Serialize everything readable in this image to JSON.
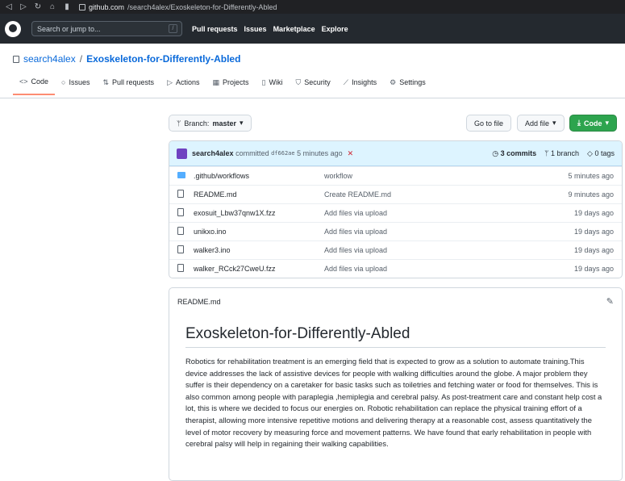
{
  "browser": {
    "url_host": "github.com",
    "url_path": "/search4alex/Exoskeleton-for-Differently-Abled"
  },
  "header": {
    "search_placeholder": "Search or jump to...",
    "search_shortcut": "/",
    "nav": [
      "Pull requests",
      "Issues",
      "Marketplace",
      "Explore"
    ]
  },
  "repo": {
    "owner": "search4alex",
    "separator": "/",
    "name": "Exoskeleton-for-Differently-Abled"
  },
  "tabs": [
    {
      "label": "Code",
      "icon": "<>"
    },
    {
      "label": "Issues",
      "icon": "○"
    },
    {
      "label": "Pull requests",
      "icon": "⇅"
    },
    {
      "label": "Actions",
      "icon": "▷"
    },
    {
      "label": "Projects",
      "icon": "▦"
    },
    {
      "label": "Wiki",
      "icon": "▯"
    },
    {
      "label": "Security",
      "icon": "⛉"
    },
    {
      "label": "Insights",
      "icon": "⟋"
    },
    {
      "label": "Settings",
      "icon": "⚙"
    }
  ],
  "toolbar": {
    "branch_label": "Branch:",
    "branch_name": "master",
    "go_to_file": "Go to file",
    "add_file": "Add file",
    "code": "Code"
  },
  "commit": {
    "author": "search4alex",
    "verb": "committed",
    "sha": "df662ae",
    "time": "5 minutes ago",
    "commits": "3 commits",
    "branches": "1 branch",
    "tags": "0 tags"
  },
  "files": [
    {
      "type": "dir",
      "name": ".github/workflows",
      "message": "workflow",
      "age": "5 minutes ago"
    },
    {
      "type": "file",
      "name": "README.md",
      "message": "Create README.md",
      "age": "9 minutes ago"
    },
    {
      "type": "file",
      "name": "exosuit_Lbw37qnw1X.fzz",
      "message": "Add files via upload",
      "age": "19 days ago"
    },
    {
      "type": "file",
      "name": "unikxo.ino",
      "message": "Add files via upload",
      "age": "19 days ago"
    },
    {
      "type": "file",
      "name": "walker3.ino",
      "message": "Add files via upload",
      "age": "19 days ago"
    },
    {
      "type": "file",
      "name": "walker_RCck27CweU.fzz",
      "message": "Add files via upload",
      "age": "19 days ago"
    }
  ],
  "readme": {
    "filename": "README.md",
    "title": "Exoskeleton-for-Differently-Abled",
    "body": "Robotics for rehabilitation treatment is an emerging field that is expected to grow as a solution to automate training.This device addresses the lack of assistive devices for people with walking difficulties around the globe. A major problem they suffer is their dependency on a caretaker for basic tasks such as toiletries and fetching water or food for themselves. This is also common among people with paraplegia ,hemiplegia and cerebral palsy. As post-treatment care and constant help cost a lot, this is where we decided to focus our energies on. Robotic rehabilitation can replace the physical training effort of a therapist, allowing more intensive repetitive motions and delivering therapy at a reasonable cost, assess quantitatively the level of motor recovery by measuring force and movement patterns. We have found that early rehabilitation in people with cerebral palsy will help in regaining their walking capabilities."
  }
}
